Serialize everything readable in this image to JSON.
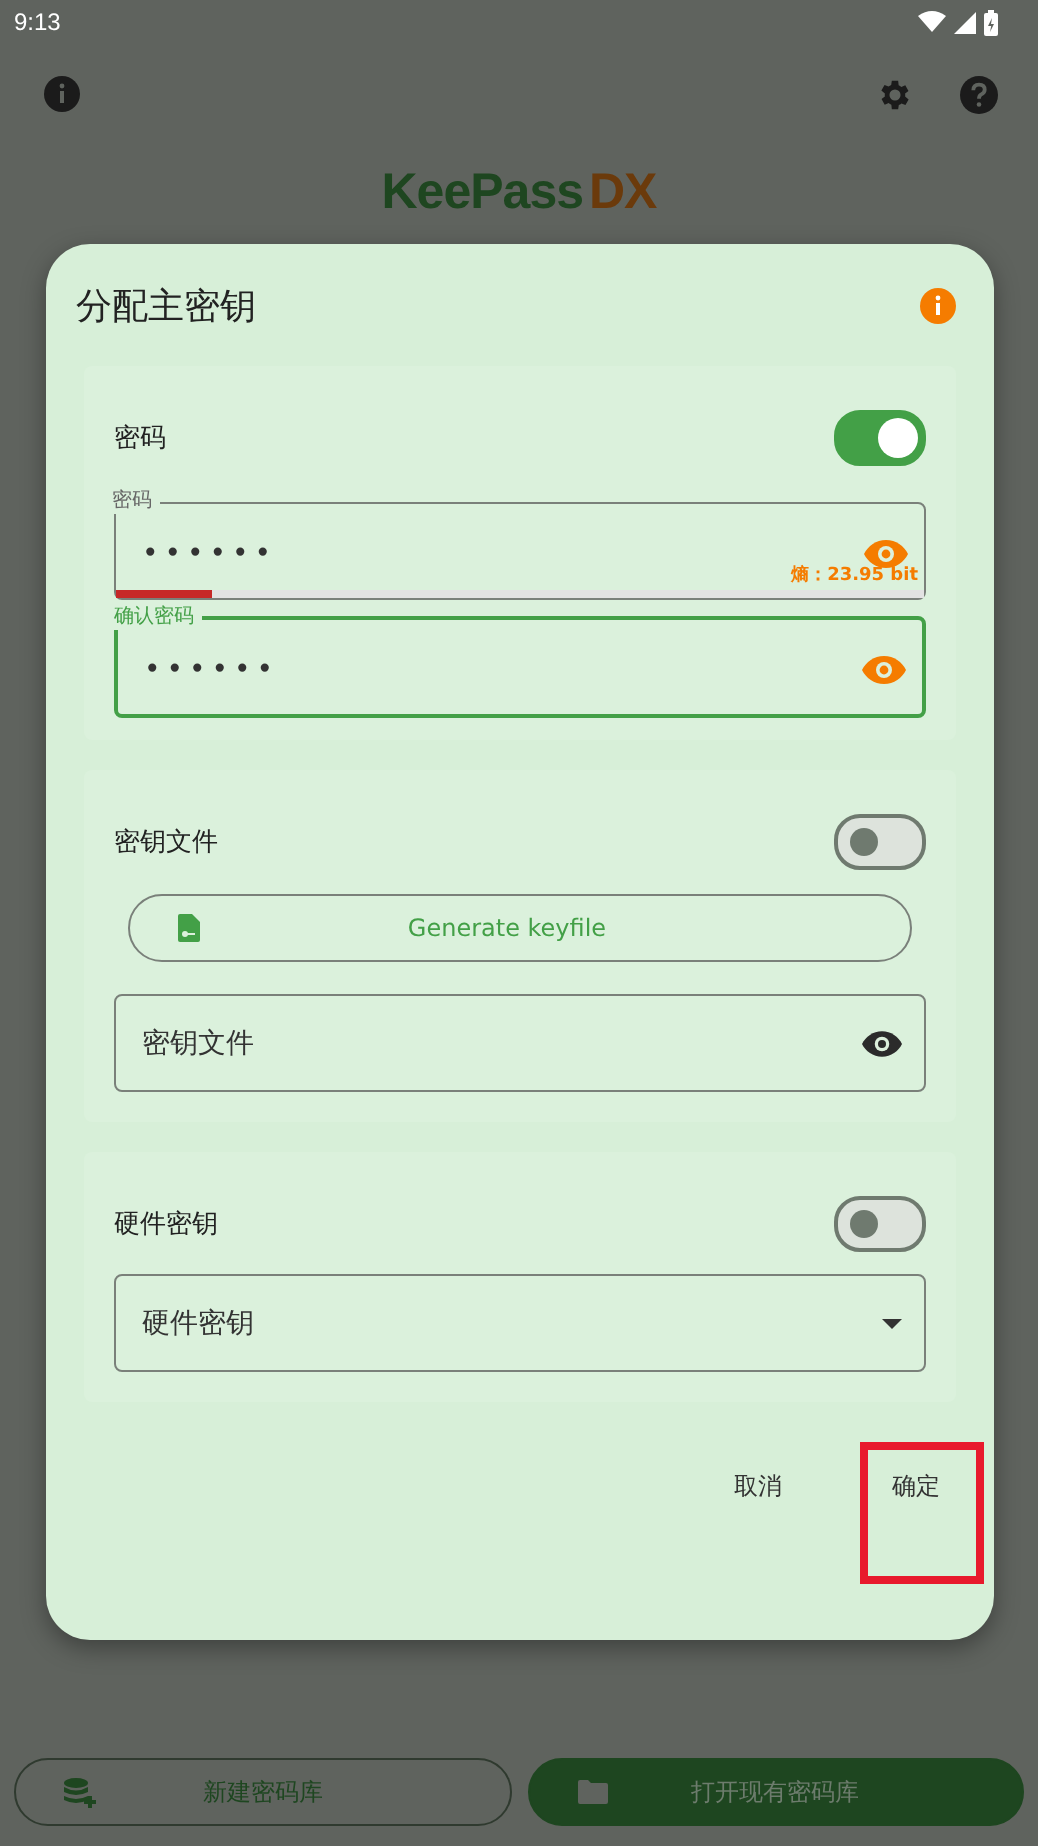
{
  "status_bar": {
    "time": "9:13"
  },
  "logo": {
    "part_1": "KeePass",
    "part_2": "DX"
  },
  "dialog": {
    "title": "分配主密钥",
    "sections": [
      {
        "kind": "password",
        "label": "密码",
        "on": true,
        "fields": [
          {
            "label": "密码",
            "value": "••••••",
            "focused": false,
            "strength": {
              "level": 0.12
            },
            "entropy": "熵：23.95 bit"
          },
          {
            "label": "确认密码",
            "value": "••••••",
            "focused": true
          }
        ]
      },
      {
        "kind": "keyfile",
        "label": "密钥文件",
        "on": false,
        "button": "Generate keyfile",
        "field": {
          "placeholder": "密钥文件"
        }
      },
      {
        "kind": "hardware",
        "label": "硬件密钥",
        "on": false,
        "field": {
          "placeholder": "硬件密钥"
        }
      }
    ],
    "actions": [
      {
        "label": "取消",
        "highlighted": false
      },
      {
        "label": "确定",
        "highlighted": true
      }
    ]
  },
  "bottom_buttons": [
    {
      "kind": "new",
      "label": "新建密码库",
      "filled": false
    },
    {
      "kind": "open",
      "label": "打开现有密码库",
      "filled": true
    }
  ]
}
